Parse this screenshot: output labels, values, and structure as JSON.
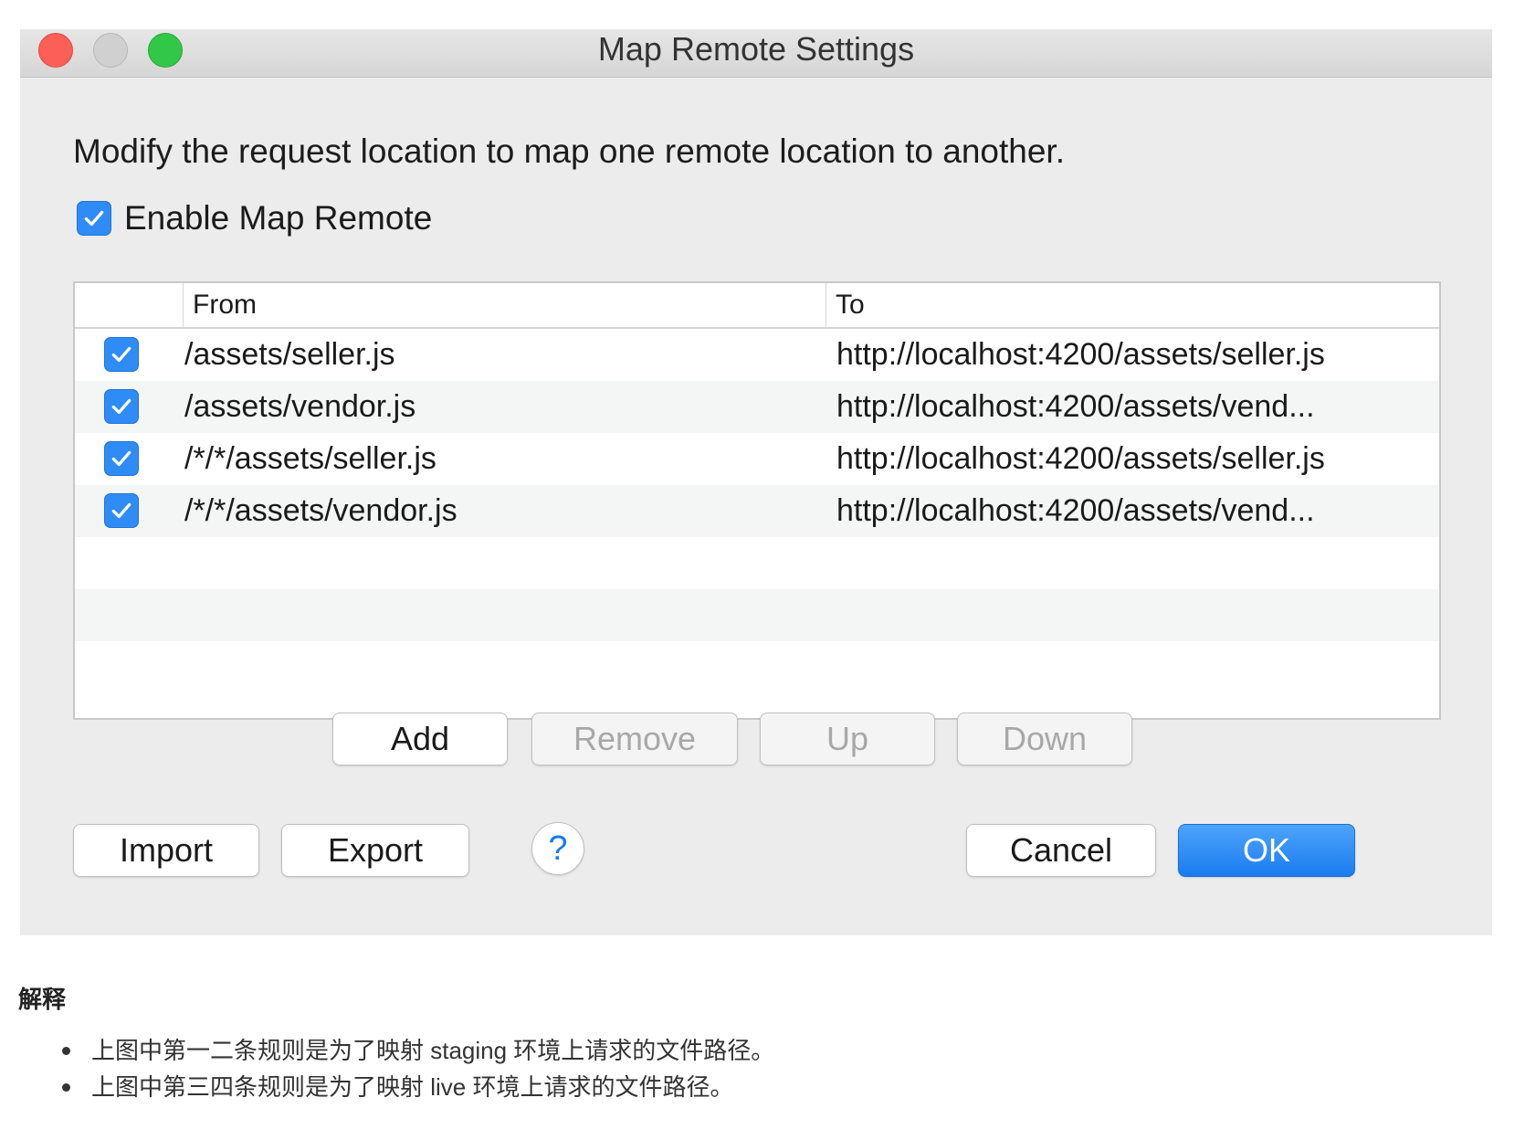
{
  "window": {
    "title": "Map Remote Settings",
    "description": "Modify the request location to map one remote location to another.",
    "enable_label": "Enable Map Remote",
    "enable_checked": true
  },
  "table": {
    "columns": {
      "from": "From",
      "to": "To"
    },
    "rows": [
      {
        "checked": true,
        "from": "/assets/seller.js",
        "to": "http://localhost:4200/assets/seller.js"
      },
      {
        "checked": true,
        "from": "/assets/vendor.js",
        "to": "http://localhost:4200/assets/vend..."
      },
      {
        "checked": true,
        "from": "/*/*/assets/seller.js",
        "to": "http://localhost:4200/assets/seller.js"
      },
      {
        "checked": true,
        "from": "/*/*/assets/vendor.js",
        "to": "http://localhost:4200/assets/vend..."
      }
    ]
  },
  "table_buttons": {
    "add": "Add",
    "remove": "Remove",
    "up": "Up",
    "down": "Down"
  },
  "footer_buttons": {
    "import": "Import",
    "export": "Export",
    "help": "?",
    "cancel": "Cancel",
    "ok": "OK"
  },
  "explanation": {
    "heading": "解释",
    "items": [
      "上图中第一二条规则是为了映射 staging 环境上请求的文件路径。",
      "上图中第三四条规则是为了映射 live 环境上请求的文件路径。"
    ]
  },
  "colors": {
    "accent": "#2f8cf6",
    "close": "#fc5f57",
    "maximize": "#33c748"
  },
  "icons": {
    "checkbox": "checkmark-icon",
    "help": "question-mark-icon"
  }
}
